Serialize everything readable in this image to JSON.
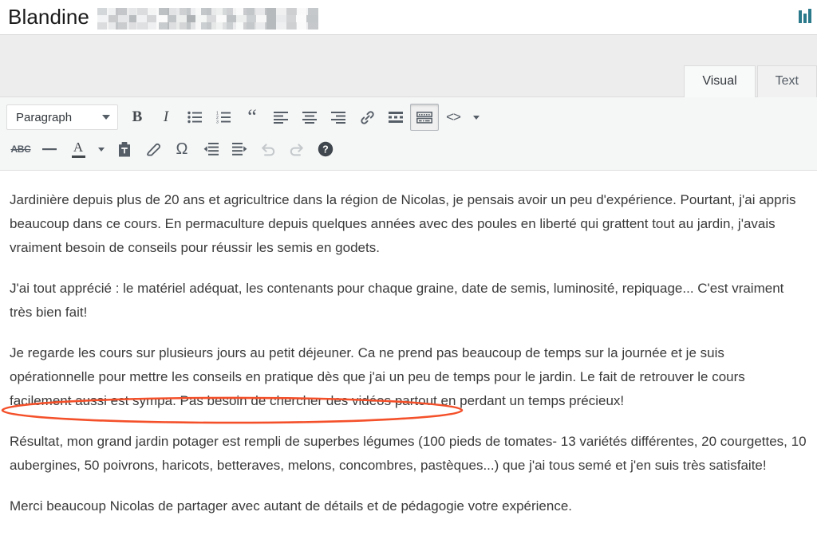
{
  "header": {
    "title": "Blandine",
    "redacted_label": "redacted-name",
    "menu_icon": "bar-chart-icon"
  },
  "tabs": [
    {
      "label": "Visual",
      "active": true
    },
    {
      "label": "Text",
      "active": false
    }
  ],
  "toolbar": {
    "format_select": {
      "value": "Paragraph",
      "icon": "chevron-down-icon"
    },
    "row1": [
      {
        "name": "bold-button",
        "glyph": "B"
      },
      {
        "name": "italic-button",
        "glyph": "I"
      },
      {
        "name": "bulleted-list-button",
        "glyph": ""
      },
      {
        "name": "numbered-list-button",
        "glyph": ""
      },
      {
        "name": "blockquote-button",
        "glyph": "“"
      },
      {
        "name": "align-left-button",
        "glyph": ""
      },
      {
        "name": "align-center-button",
        "glyph": ""
      },
      {
        "name": "align-right-button",
        "glyph": ""
      },
      {
        "name": "insert-link-button",
        "glyph": ""
      },
      {
        "name": "read-more-button",
        "glyph": ""
      },
      {
        "name": "toolbar-toggle-button",
        "glyph": ""
      },
      {
        "name": "code-button",
        "glyph": "<>"
      },
      {
        "name": "code-dropdown-button",
        "glyph": ""
      }
    ],
    "row2": [
      {
        "name": "strikethrough-button",
        "glyph": "ABC"
      },
      {
        "name": "horizontal-line-button",
        "glyph": "—"
      },
      {
        "name": "text-color-button",
        "glyph": "A"
      },
      {
        "name": "text-color-dropdown-button",
        "glyph": ""
      },
      {
        "name": "paste-as-text-button",
        "glyph": ""
      },
      {
        "name": "clear-formatting-button",
        "glyph": ""
      },
      {
        "name": "special-character-button",
        "glyph": "Ω"
      },
      {
        "name": "decrease-indent-button",
        "glyph": ""
      },
      {
        "name": "increase-indent-button",
        "glyph": ""
      },
      {
        "name": "undo-button",
        "glyph": ""
      },
      {
        "name": "redo-button",
        "glyph": ""
      },
      {
        "name": "keyboard-shortcuts-button",
        "glyph": "?"
      }
    ]
  },
  "content": {
    "paragraphs": [
      "Jardinière depuis plus de 20 ans et agricultrice dans la région de Nicolas, je pensais avoir un peu d'expérience. Pourtant, j'ai appris beaucoup dans ce cours. En permaculture depuis quelques années avec des poules en liberté qui grattent tout au jardin, j'avais vraiment besoin de conseils pour réussir les semis en godets.",
      "J'ai tout apprécié : le matériel adéquat, les contenants pour chaque graine, date de semis, luminosité, repiquage... C'est vraiment très bien fait!",
      "Je regarde les cours sur plusieurs jours au petit déjeuner. Ca ne prend pas beaucoup de temps sur la journée et je suis opérationnelle pour mettre les conseils en pratique dès que j'ai un peu de temps pour le jardin. Le fait de retrouver le cours facilement aussi est sympa. Pas besoin de chercher des vidéos partout en perdant un temps précieux!",
      "Résultat, mon grand jardin potager est rempli de superbes légumes (100 pieds de tomates- 13 variétés différentes, 20 courgettes, 10 aubergines, 50 poivrons, haricots, betteraves, melons, concombres, pastèques...) que j'ai tous semé et j'en suis très satisfaite!",
      "Merci beaucoup Nicolas de partager avec autant de détails et de pédagogie votre expérience."
    ],
    "annotation": {
      "name": "red-ellipse-highlight",
      "encircled_text": "Résultat, mon grand jardin potager est rempli de superbes légumes",
      "color": "#f4502a"
    }
  },
  "colors": {
    "accent_teal": "#2b7a8c",
    "toolbar_bg": "#f5f6f6",
    "band_bg": "#ededed",
    "text": "#3a3a3a",
    "icon": "#555d66"
  }
}
